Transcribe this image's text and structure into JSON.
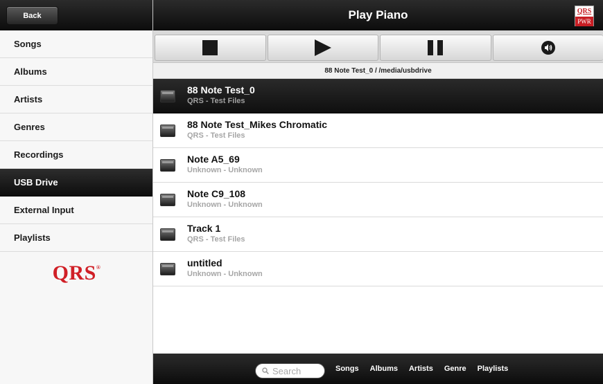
{
  "sidebar": {
    "back_label": "Back",
    "items": [
      {
        "label": "Songs",
        "active": false
      },
      {
        "label": "Albums",
        "active": false
      },
      {
        "label": "Artists",
        "active": false
      },
      {
        "label": "Genres",
        "active": false
      },
      {
        "label": "Recordings",
        "active": false
      },
      {
        "label": "USB Drive",
        "active": true
      },
      {
        "label": "External Input",
        "active": false
      },
      {
        "label": "Playlists",
        "active": false
      }
    ],
    "logo_text": "QRS",
    "logo_mark": "®"
  },
  "header": {
    "title": "Play Piano",
    "badge_top": "QRS",
    "badge_bottom": "PWR"
  },
  "controls": [
    {
      "icon": "stop-icon"
    },
    {
      "icon": "play-icon"
    },
    {
      "icon": "pause-icon"
    },
    {
      "icon": "volume-icon"
    }
  ],
  "now_playing_path": "88 Note Test_0 / /media/usbdrive",
  "tracks": [
    {
      "title": "88 Note Test_0",
      "subtitle": "QRS - Test Files",
      "active": true
    },
    {
      "title": "88 Note Test_Mikes Chromatic",
      "subtitle": "QRS - Test Files",
      "active": false
    },
    {
      "title": "Note A5_69",
      "subtitle": "Unknown - Unknown",
      "active": false
    },
    {
      "title": "Note C9_108",
      "subtitle": "Unknown - Unknown",
      "active": false
    },
    {
      "title": "Track 1",
      "subtitle": "QRS - Test Files",
      "active": false
    },
    {
      "title": "untitled",
      "subtitle": "Unknown - Unknown",
      "active": false
    }
  ],
  "bottom_bar": {
    "search_placeholder": "Search",
    "tabs": [
      "Songs",
      "Albums",
      "Artists",
      "Genre",
      "Playlists"
    ]
  },
  "colors": {
    "brand_red": "#d01f26",
    "bar_dark": "#0c0c0c",
    "muted_text": "#a6a6a6"
  }
}
